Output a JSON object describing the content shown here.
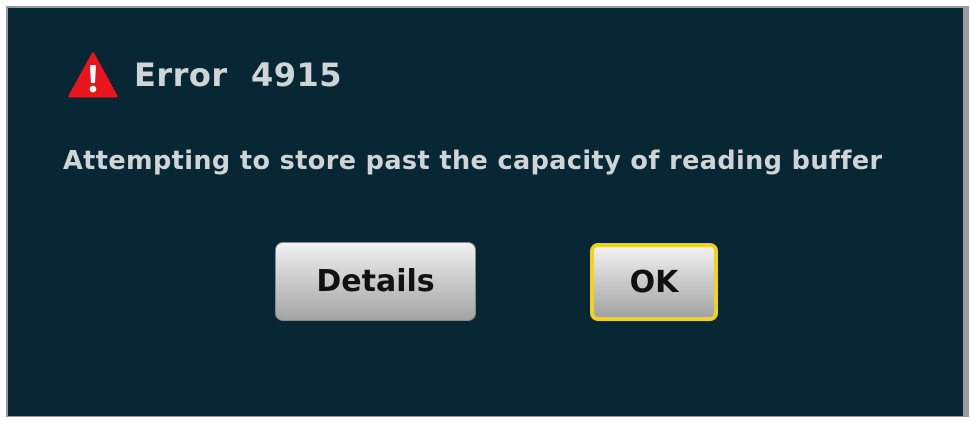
{
  "dialog": {
    "title": "Error  4915",
    "icon": "warning-icon",
    "message": "Attempting to store past the capacity of reading buffer",
    "buttons": {
      "details_label": "Details",
      "ok_label": "OK"
    }
  },
  "colors": {
    "background": "#062733",
    "text": "#cfd4d6",
    "warning_icon": "#e8161c",
    "focus_border": "#f3d21c"
  }
}
